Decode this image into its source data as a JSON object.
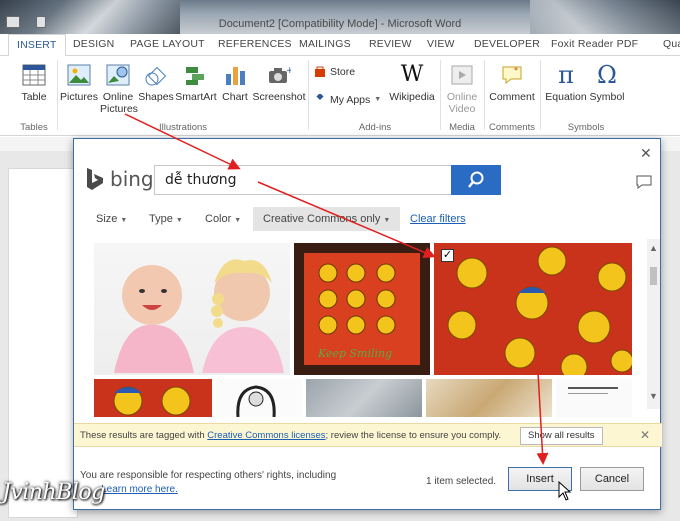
{
  "window": {
    "title": "Document2 [Compatibility Mode] - Microsoft Word"
  },
  "tabs": [
    "INSERT",
    "DESIGN",
    "PAGE LAYOUT",
    "REFERENCES",
    "MAILINGS",
    "REVIEW",
    "VIEW",
    "DEVELOPER",
    "Foxit Reader PDF",
    "Qua"
  ],
  "ribbon": {
    "table": "Table",
    "pictures": "Pictures",
    "online_pictures": "Online Pictures",
    "shapes": "Shapes",
    "smartart": "SmartArt",
    "chart": "Chart",
    "screenshot": "Screenshot",
    "store": "Store",
    "my_apps": "My Apps",
    "wikipedia": "Wikipedia",
    "online_video": "Online Video",
    "comment": "Comment",
    "equation": "Equation",
    "symbol": "Symbol",
    "groups": {
      "tables": "Tables",
      "illustrations": "Illustrations",
      "addins": "Add-ins",
      "media": "Media",
      "comments": "Comments",
      "symbols": "Symbols"
    }
  },
  "dialog": {
    "brand": "bing",
    "search_value": "dễ thương",
    "filters": {
      "size": "Size",
      "type": "Type",
      "color": "Color",
      "cc": "Creative Commons only",
      "clear": "Clear filters"
    },
    "notice": {
      "prefix": "These results are tagged with ",
      "link": "Creative Commons licenses",
      "suffix": "; review the license to ensure you comply.",
      "show_all": "Show all results"
    },
    "footer": {
      "line1": "You are responsible for respecting others' rights, including",
      "learn_more": "Learn more here."
    },
    "selected_count": "1 item selected.",
    "insert": "Insert",
    "cancel": "Cancel"
  },
  "watermark": "JvinhBlog",
  "colors": {
    "accent": "#2b579a",
    "bing_blue": "#2a6bc4",
    "arrow": "#e02020",
    "notice_bg": "#fdf6d3"
  }
}
